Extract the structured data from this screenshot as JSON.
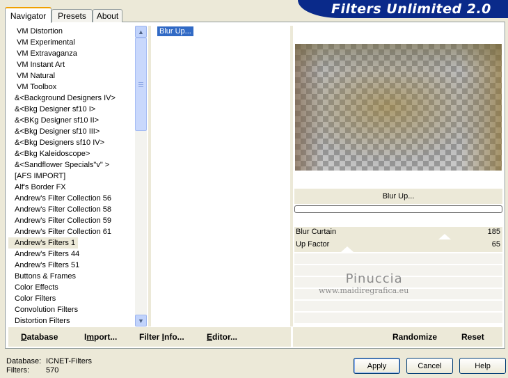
{
  "banner": {
    "title": "Filters Unlimited 2.0"
  },
  "tabs": [
    {
      "label": "Navigator"
    },
    {
      "label": "Presets"
    },
    {
      "label": "About"
    }
  ],
  "categories": [
    "VM Distortion",
    "VM Experimental",
    "VM Extravaganza",
    "VM Instant Art",
    "VM Natural",
    "VM Toolbox",
    "&<Background Designers IV>",
    "&<Bkg Designer sf10 I>",
    "&<BKg Designer sf10 II>",
    "&<Bkg Designer sf10 III>",
    "&<Bkg Designers sf10 IV>",
    "&<Bkg Kaleidoscope>",
    "&<Sandflower Specials\"v\" >",
    "[AFS IMPORT]",
    "Alf's Border FX",
    "Andrew's Filter Collection 56",
    "Andrew's Filter Collection 58",
    "Andrew's Filter Collection 59",
    "Andrew's Filter Collection 61",
    "Andrew's Filters 1",
    "Andrew's Filters 44",
    "Andrew's Filters 51",
    "Buttons & Frames",
    "Color Effects",
    "Color Filters",
    "Convolution Filters",
    "Distortion Filters"
  ],
  "selected_category_index": 19,
  "filters": {
    "selected": "Blur Up..."
  },
  "filter_name": "Blur Up...",
  "params": [
    {
      "label": "Blur Curtain",
      "value": "185"
    },
    {
      "label": "Up Factor",
      "value": "65"
    }
  ],
  "watermark": {
    "name": "Pinuccia",
    "url": "www.maidiregrafica.eu"
  },
  "toolbar": {
    "database_u": "D",
    "database_rest": "atabase",
    "import_pre": "I",
    "import_u": "m",
    "import_rest": "port...",
    "info_pre": "Filter ",
    "info_u": "I",
    "info_rest": "nfo...",
    "editor_u": "E",
    "editor_rest": "ditor...",
    "randomize": "Randomize",
    "reset": "Reset"
  },
  "status": {
    "database_label": "Database:",
    "database_value": "ICNET-Filters",
    "filters_label": "Filters:",
    "filters_value": "570"
  },
  "buttons": {
    "apply": "Apply",
    "cancel": "Cancel",
    "help": "Help"
  }
}
